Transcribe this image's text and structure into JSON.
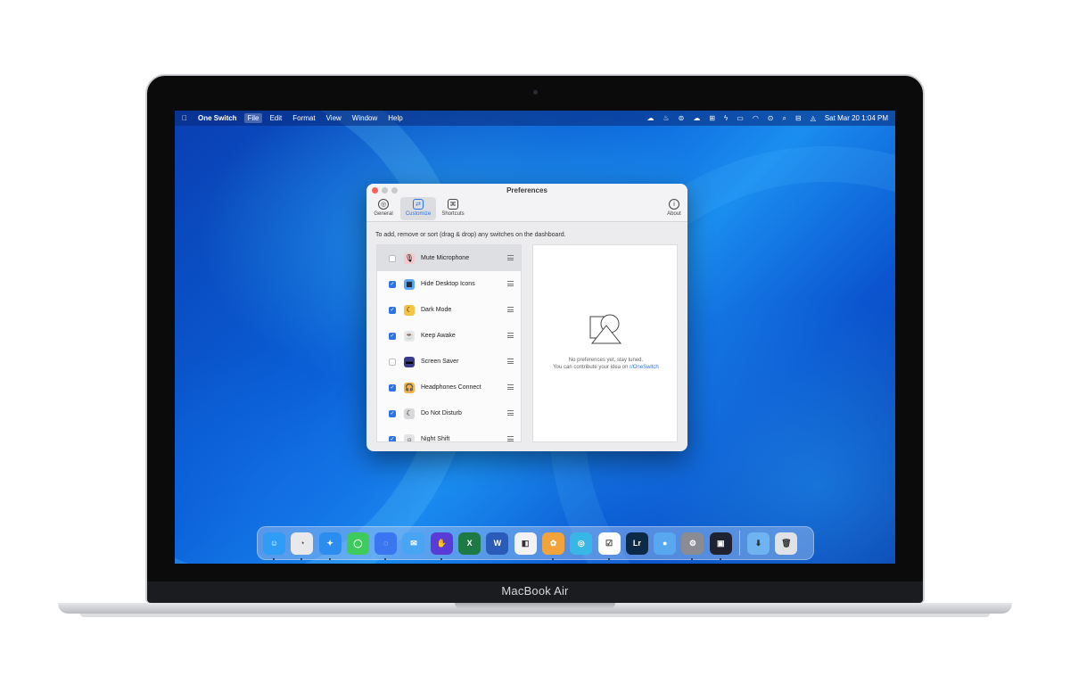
{
  "device": {
    "brand_label": "MacBook Air"
  },
  "menubar": {
    "apple": "",
    "app_name": "One Switch",
    "menus": [
      "File",
      "Edit",
      "Format",
      "View",
      "Window",
      "Help"
    ],
    "clock": "Sat Mar 20  1:04 PM",
    "status_icons": [
      "cloud-icon",
      "flame-icon",
      "tag-icon",
      "cloud-fill-icon",
      "grid-icon",
      "bolt-icon",
      "battery-icon",
      "wifi-icon",
      "play-icon",
      "search-icon",
      "control-center-icon",
      "notification-icon"
    ]
  },
  "window": {
    "title": "Preferences",
    "tabs": [
      {
        "label": "General",
        "icon": "general-icon"
      },
      {
        "label": "Customize",
        "icon": "customize-icon"
      },
      {
        "label": "Shortcuts",
        "icon": "command-icon"
      }
    ],
    "about_label": "About",
    "instructions": "To add, remove or sort (drag & drop) any switches on the dashboard.",
    "switches": [
      {
        "label": "Mute Microphone",
        "checked": false,
        "icon": "microphone-icon",
        "glyph": "🎙",
        "color": "#f3c9c9"
      },
      {
        "label": "Hide Desktop Icons",
        "checked": true,
        "icon": "desktop-grid-icon",
        "glyph": "▦",
        "color": "#5ea7f2"
      },
      {
        "label": "Dark Mode",
        "checked": true,
        "icon": "moon-icon",
        "glyph": "☾",
        "color": "#f6c343"
      },
      {
        "label": "Keep Awake",
        "checked": true,
        "icon": "cup-icon",
        "glyph": "☕",
        "color": "#e9e9ea"
      },
      {
        "label": "Screen Saver",
        "checked": false,
        "icon": "screen-saver-icon",
        "glyph": "▬",
        "color": "#3b3b8a"
      },
      {
        "label": "Headphones Connect",
        "checked": true,
        "icon": "headphones-icon",
        "glyph": "🎧",
        "color": "#f5b24a"
      },
      {
        "label": "Do Not Disturb",
        "checked": true,
        "icon": "moon-slash-icon",
        "glyph": "☾",
        "color": "#d8d8da"
      },
      {
        "label": "Night Shift",
        "checked": true,
        "icon": "night-shift-icon",
        "glyph": "☼",
        "color": "#e3e3e5"
      }
    ],
    "detail": {
      "empty_text": "No preferences yet, stay tuned.",
      "contribute_text": "You can contribute your idea on ",
      "contribute_link": "r/OneSwitch"
    }
  },
  "dock": {
    "apps": [
      {
        "name": "finder-icon",
        "color": "#2f9df5",
        "glyph": "☺",
        "running": true
      },
      {
        "name": "activity-monitor-icon",
        "color": "#e9e9eb",
        "glyph": "◔",
        "running": true
      },
      {
        "name": "safari-icon",
        "color": "#2b8df0",
        "glyph": "✦",
        "running": true
      },
      {
        "name": "messages-icon",
        "color": "#3ecb5b",
        "glyph": "◯",
        "running": false
      },
      {
        "name": "signal-icon",
        "color": "#3a76f0",
        "glyph": "◌",
        "running": true
      },
      {
        "name": "mail-icon",
        "color": "#4aa4f4",
        "glyph": "✉",
        "running": false
      },
      {
        "name": "hand-app-icon",
        "color": "#5a3bd6",
        "glyph": "✋",
        "running": true
      },
      {
        "name": "excel-icon",
        "color": "#1e7a45",
        "glyph": "X",
        "running": false
      },
      {
        "name": "word-icon",
        "color": "#2a5bb8",
        "glyph": "W",
        "running": false
      },
      {
        "name": "cardhop-icon",
        "color": "#f2f2f4",
        "glyph": "◧",
        "running": false
      },
      {
        "name": "tes-butterfly-icon",
        "color": "#f2a43a",
        "glyph": "✿",
        "running": true
      },
      {
        "name": "spiral-app-icon",
        "color": "#37b7e6",
        "glyph": "◎",
        "running": false
      },
      {
        "name": "things-icon",
        "color": "#ffffff",
        "glyph": "☑",
        "running": true
      },
      {
        "name": "lightroom-icon",
        "color": "#0c2a48",
        "glyph": "Lr",
        "running": false
      },
      {
        "name": "tweetbot-icon",
        "color": "#58a8f0",
        "glyph": "●",
        "running": false
      },
      {
        "name": "system-preferences-icon",
        "color": "#8a8c92",
        "glyph": "⚙",
        "running": true
      },
      {
        "name": "one-switch-icon",
        "color": "#1f2230",
        "glyph": "▣",
        "running": true
      }
    ],
    "extras": [
      {
        "name": "downloads-folder-icon",
        "color": "#6fb3f0",
        "glyph": "⬇"
      },
      {
        "name": "trash-icon",
        "color": "#e1e2e6",
        "glyph": "🗑"
      }
    ]
  }
}
